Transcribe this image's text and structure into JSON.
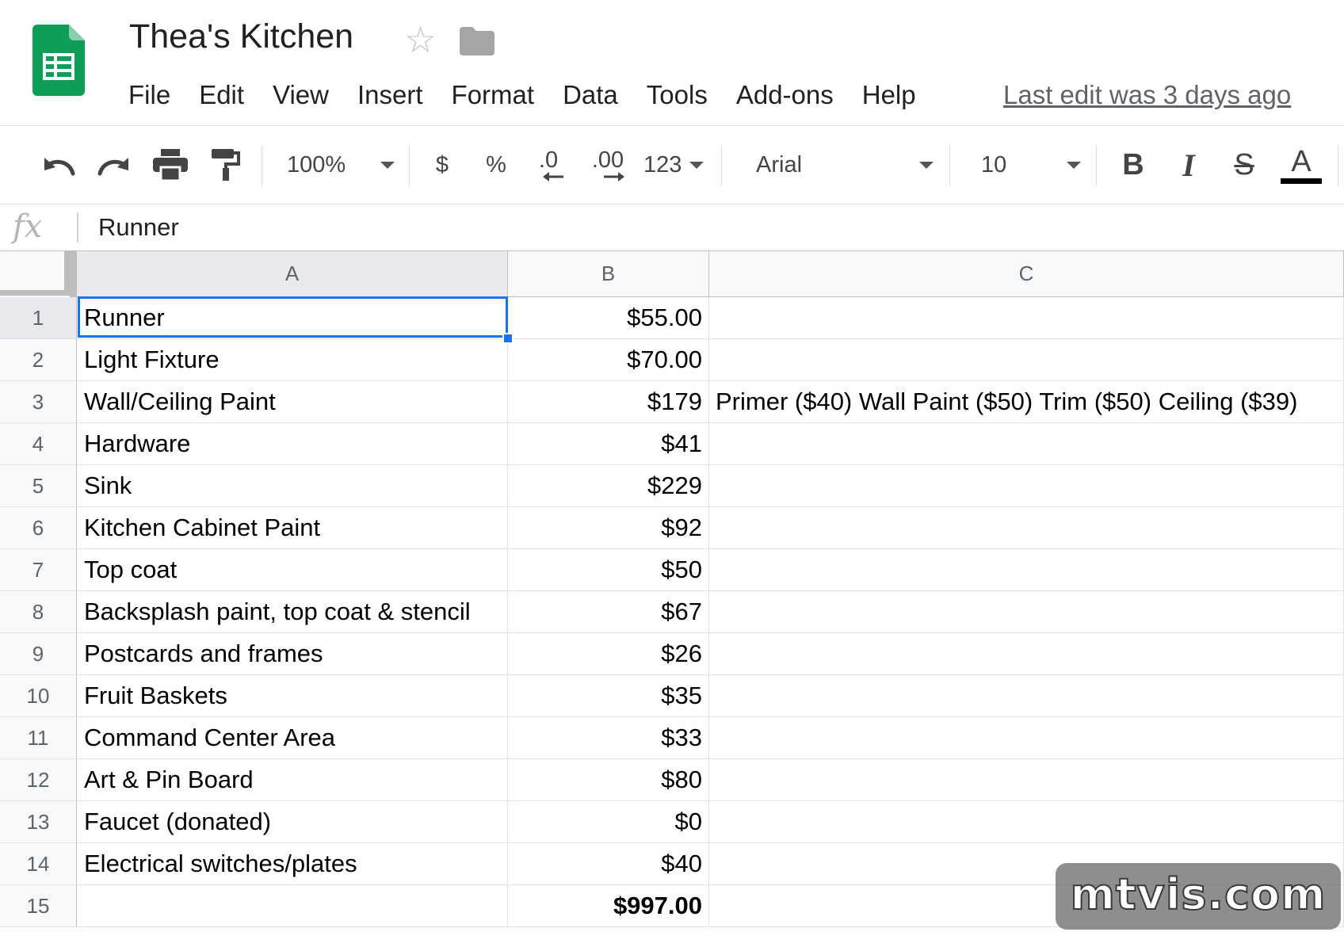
{
  "document": {
    "title": "Thea's Kitchen",
    "last_edit": "Last edit was 3 days ago"
  },
  "menu": [
    "File",
    "Edit",
    "View",
    "Insert",
    "Format",
    "Data",
    "Tools",
    "Add-ons",
    "Help"
  ],
  "toolbar": {
    "zoom": "100%",
    "currency": "$",
    "percent": "%",
    "decrease_decimal": ".0",
    "increase_decimal": ".00",
    "more_formats": "123",
    "font": "Arial",
    "font_size": "10",
    "bold": "B",
    "italic": "I",
    "strikethrough": "S",
    "text_color": "A"
  },
  "formula_bar": {
    "fx": "fx",
    "value": "Runner"
  },
  "columns": [
    "A",
    "B",
    "C"
  ],
  "selected_cell": "A1",
  "rows": [
    {
      "n": "1",
      "a": "Runner",
      "b": "$55.00",
      "c": ""
    },
    {
      "n": "2",
      "a": "Light Fixture",
      "b": "$70.00",
      "c": ""
    },
    {
      "n": "3",
      "a": "Wall/Ceiling Paint",
      "b": "$179",
      "c": "Primer ($40) Wall Paint ($50) Trim ($50) Ceiling ($39)"
    },
    {
      "n": "4",
      "a": "Hardware",
      "b": "$41",
      "c": ""
    },
    {
      "n": "5",
      "a": "Sink",
      "b": "$229",
      "c": ""
    },
    {
      "n": "6",
      "a": "Kitchen Cabinet Paint",
      "b": "$92",
      "c": ""
    },
    {
      "n": "7",
      "a": "Top coat",
      "b": "$50",
      "c": ""
    },
    {
      "n": "8",
      "a": "Backsplash paint, top coat & stencil",
      "b": "$67",
      "c": ""
    },
    {
      "n": "9",
      "a": "Postcards and frames",
      "b": "$26",
      "c": ""
    },
    {
      "n": "10",
      "a": "Fruit Baskets",
      "b": "$35",
      "c": ""
    },
    {
      "n": "11",
      "a": "Command Center Area",
      "b": "$33",
      "c": ""
    },
    {
      "n": "12",
      "a": "Art & Pin Board",
      "b": "$80",
      "c": ""
    },
    {
      "n": "13",
      "a": "Faucet (donated)",
      "b": "$0",
      "c": ""
    },
    {
      "n": "14",
      "a": "Electrical switches/plates",
      "b": "$40",
      "c": ""
    },
    {
      "n": "15",
      "a": "",
      "b": "$997.00",
      "c": ""
    }
  ],
  "watermark": "mtvis.com",
  "colors": {
    "sheets_green": "#0f9d58",
    "selection_blue": "#1a73e8"
  },
  "icons": [
    "sheets-logo-icon",
    "star-icon",
    "folder-icon",
    "undo-icon",
    "redo-icon",
    "print-icon",
    "paint-format-icon"
  ]
}
